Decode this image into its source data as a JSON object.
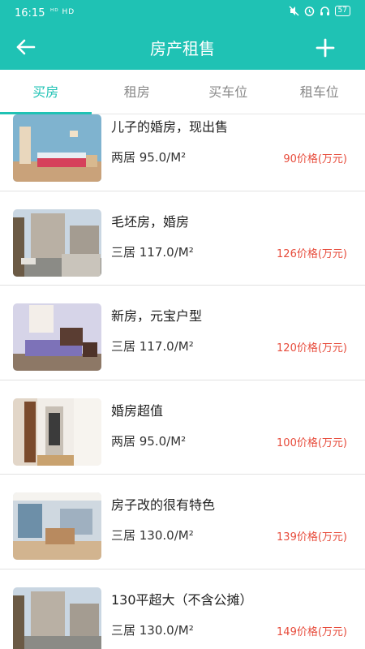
{
  "status_bar": {
    "time": "16:15",
    "network": "ᴴᴰ HD",
    "battery": "57"
  },
  "appbar": {
    "title": "房产租售",
    "back_icon": "arrow-left-icon",
    "add_icon": "plus-icon",
    "bg_color": "#1fc2b4"
  },
  "tabs": [
    {
      "label": "买房",
      "active": true
    },
    {
      "label": "租房",
      "active": false
    },
    {
      "label": "买车位",
      "active": false
    },
    {
      "label": "租车位",
      "active": false
    }
  ],
  "listings": [
    {
      "title": "儿子的婚房，现出售",
      "spec": "两居 95.0/M²",
      "price": "90价格(万元)"
    },
    {
      "title": "毛坯房，婚房",
      "spec": "三居 117.0/M²",
      "price": "126价格(万元)"
    },
    {
      "title": "新房，元宝户型",
      "spec": "三居 117.0/M²",
      "price": "120价格(万元)"
    },
    {
      "title": "婚房超值",
      "spec": "两居 95.0/M²",
      "price": "100价格(万元)"
    },
    {
      "title": "房子改的很有特色",
      "spec": "三居 130.0/M²",
      "price": "139价格(万元)"
    },
    {
      "title": "130平超大（不含公摊）",
      "spec": "三居 130.0/M²",
      "price": "149价格(万元)"
    }
  ],
  "colors": {
    "accent": "#1fc2b4",
    "price": "#e74c3c"
  }
}
